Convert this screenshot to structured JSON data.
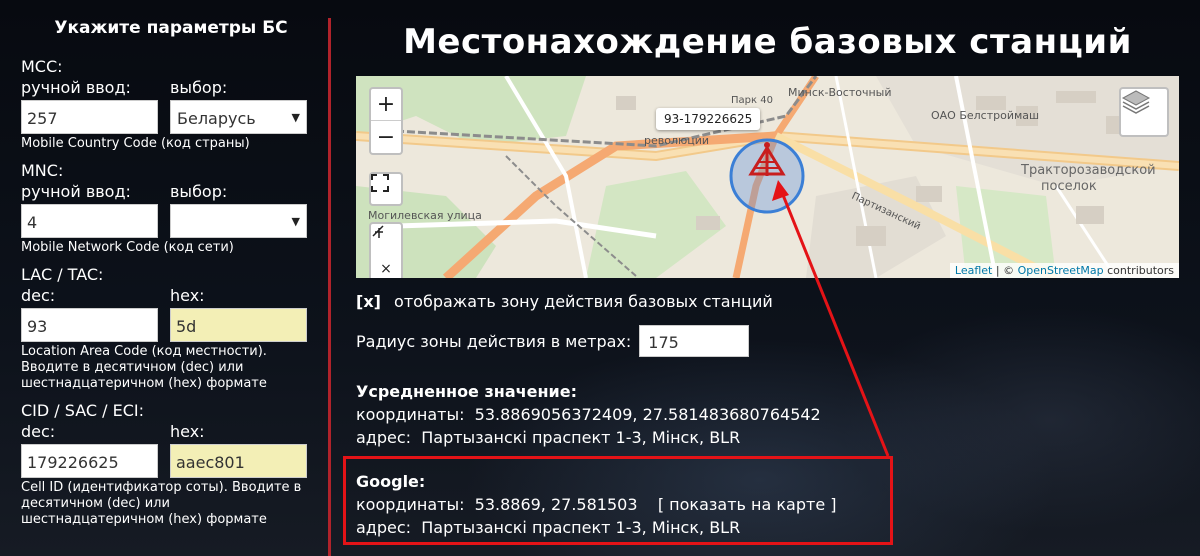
{
  "sidebar": {
    "title": "Укажите параметры БС",
    "mcc": {
      "label": "MCC:",
      "manual_label": "ручной ввод:",
      "select_label": "выбор:",
      "value": "257",
      "selected": "Беларусь",
      "hint": "Mobile Country Code (код страны)"
    },
    "mnc": {
      "label": "MNC:",
      "manual_label": "ручной ввод:",
      "select_label": "выбор:",
      "value": "4",
      "selected": "",
      "hint": "Mobile Network Code (код сети)"
    },
    "lac": {
      "label": "LAC / TAC:",
      "dec_label": "dec:",
      "hex_label": "hex:",
      "dec_value": "93",
      "hex_value": "5d",
      "hint": "Location Area Code (код местности). Вводите в десятичном (dec) или шестнадцатеричном (hex) формате"
    },
    "cid": {
      "label": "CID / SAC / ECI:",
      "dec_label": "dec:",
      "hex_label": "hex:",
      "dec_value": "179226625",
      "hex_value": "aaec801",
      "hint": "Cell ID (идентификатор соты). Вводите в десятичном (dec) или шестнадцатеричном (hex) формате"
    }
  },
  "main": {
    "title": "Местонахождение базовых станций",
    "map": {
      "zoom_in": "+",
      "zoom_out": "−",
      "tooltip": "93-179226625",
      "labels": {
        "park": "Парк 40",
        "station": "Минск-Восточный",
        "revolution": "революции",
        "company": "ОАО Белстроймаш",
        "district1": "Тракторозаводской",
        "district2": "поселок",
        "street1": "Могилевская улица",
        "street2": "Партизанский"
      },
      "attribution_leaflet": "Leaflet",
      "attribution_sep": " | © ",
      "attribution_osm": "OpenStreetMap",
      "attribution_tail": " contributors"
    },
    "toggle": {
      "mark": "[x]",
      "label": "отображать зону действия базовых станций"
    },
    "radius": {
      "label": "Радиус зоны действия в метрах:",
      "value": "175"
    },
    "average": {
      "heading": "Усредненное значение:",
      "coords_label": "координаты:",
      "coords": "53.8869056372409, 27.581483680764542",
      "address_label": "адрес:",
      "address": "Партызанскі праспект 1-3, Мінск, BLR"
    },
    "google": {
      "heading": "Google:",
      "coords_label": "координаты:",
      "coords": "53.8869, 27.581503",
      "show_on_map": "[ показать на карте ]",
      "address_label": "адрес:",
      "address": "Партызанскі праспект 1-3, Мінск, BLR"
    }
  },
  "colors": {
    "accent_red": "#e41317",
    "divider": "#b0232b",
    "hex_field": "#f3efb6",
    "circle": "#3b7fd6",
    "marker": "#c81e1e"
  }
}
